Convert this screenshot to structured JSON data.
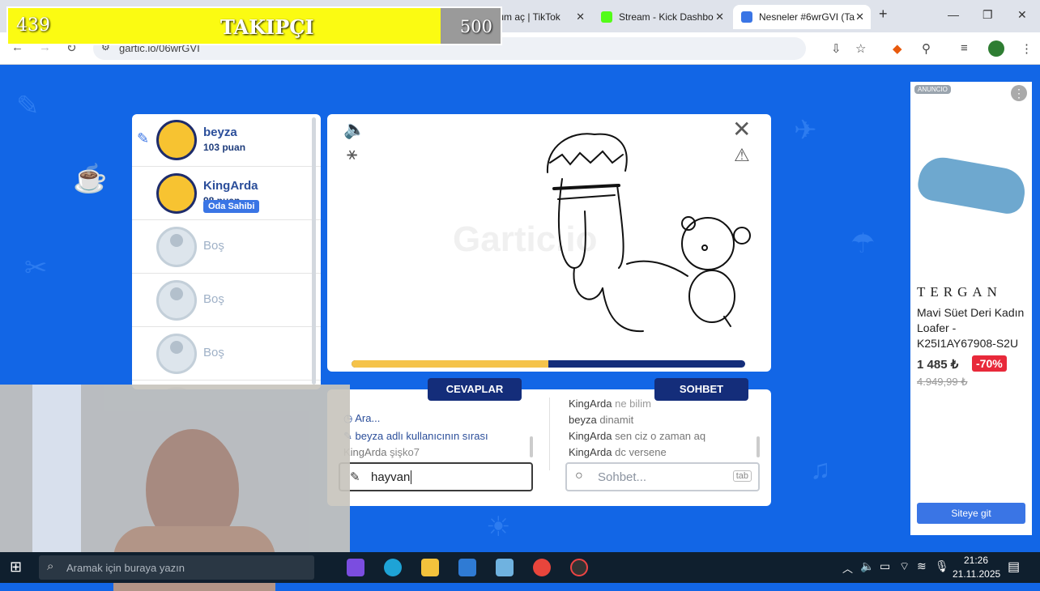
{
  "browser": {
    "tabs": [
      {
        "label": "Oturum aç | TikTok",
        "active": false
      },
      {
        "label": "Stream - Kick Dashbo",
        "active": false
      },
      {
        "label": "Nesneler #6wrGVI (Ta",
        "active": true
      }
    ],
    "url": "gartic.io/06wrGVI",
    "new_tab": "+"
  },
  "overlay": {
    "current": "439",
    "label": "TAKIPÇI",
    "goal": "500",
    "progress": 0.878
  },
  "players": [
    {
      "name": "beyza",
      "points": "103 puan",
      "drawing": true,
      "owner": ""
    },
    {
      "name": "KingArda",
      "points": "98 puan",
      "drawing": false,
      "owner": "Oda Sahibi"
    },
    {
      "name": "Boş",
      "points": "",
      "drawing": false,
      "owner": ""
    },
    {
      "name": "Boş",
      "points": "",
      "drawing": false,
      "owner": ""
    },
    {
      "name": "Boş",
      "points": "",
      "drawing": false,
      "owner": ""
    },
    {
      "name": "Boş",
      "points": "",
      "drawing": false,
      "owner": ""
    },
    {
      "name": "Boş",
      "points": "",
      "drawing": false,
      "owner": ""
    }
  ],
  "canvas": {
    "timer_progress": 0.5,
    "watermark": "Gartic.io"
  },
  "answers": {
    "tab_label": "CEVAPLAR",
    "lines": [
      {
        "user": "",
        "text": "Ara..."
      },
      {
        "user": "beyza",
        "text": "adlı kullanıcının sırası"
      },
      {
        "user": "KingArda",
        "text": "şişko7"
      }
    ],
    "input_value": "hayvan"
  },
  "chat": {
    "tab_label": "SOHBET",
    "lines": [
      {
        "user": "KingArda",
        "text": "ne bilim"
      },
      {
        "user": "beyza",
        "text": "dinamit"
      },
      {
        "user": "KingArda",
        "text": "sen ciz o zaman aq"
      },
      {
        "user": "KingArda",
        "text": "dc versene"
      }
    ],
    "input_placeholder": "Sohbet...",
    "tab_hint": "tab"
  },
  "ad": {
    "badge": "ANUNCIO",
    "brand": "TERGAN",
    "product": "Mavi Süet Deri Kadın Loafer - K25I1AY67908-S2U",
    "price": "1 485 ₺",
    "discount": "-70%",
    "old_price": "4.949,99 ₺",
    "cta": "Siteye git"
  },
  "taskbar": {
    "search_placeholder": "Aramak için buraya yazın",
    "time": "21:26",
    "date": "21.11.2025"
  },
  "colors": {
    "page_bg": "#1266e6",
    "overlay_fill": "#fbfb12",
    "timer": "#f5c34a",
    "tab_navy": "#142d7a",
    "discount": "#e8293a"
  }
}
